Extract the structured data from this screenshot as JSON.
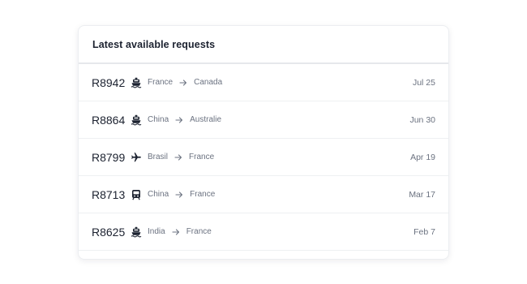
{
  "card": {
    "title": "Latest available requests"
  },
  "requests": [
    {
      "id": "R8942",
      "mode": "ship-icon",
      "from": "France",
      "to": "Canada",
      "date": "Jul 25"
    },
    {
      "id": "R8864",
      "mode": "ship-icon",
      "from": "China",
      "to": "Australie",
      "date": "Jun 30"
    },
    {
      "id": "R8799",
      "mode": "plane-icon",
      "from": "Brasil",
      "to": "France",
      "date": "Apr 19"
    },
    {
      "id": "R8713",
      "mode": "train-icon",
      "from": "China",
      "to": "France",
      "date": "Mar 17"
    },
    {
      "id": "R8625",
      "mode": "ship-icon",
      "from": "India",
      "to": "France",
      "date": "Feb 7"
    }
  ],
  "colors": {
    "text": "#1c2230",
    "muted": "#6b7280",
    "divider": "#eef0f2"
  }
}
